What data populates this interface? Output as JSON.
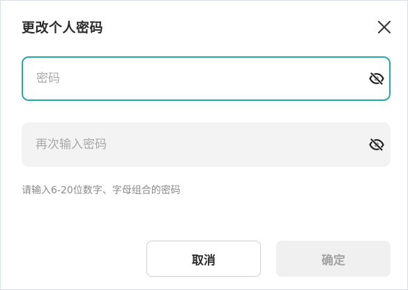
{
  "dialog": {
    "title": "更改个人密码",
    "close_icon": "close-icon"
  },
  "fields": [
    {
      "placeholder": "密码",
      "value": "",
      "toggle_icon": "eye-off-icon",
      "focused": true
    },
    {
      "placeholder": "再次输入密码",
      "value": "",
      "toggle_icon": "eye-off-icon",
      "focused": false
    }
  ],
  "hint": "请输入6-20位数字、字母组合的密码",
  "buttons": {
    "cancel_label": "取消",
    "confirm_label": "确定"
  },
  "colors": {
    "accent": "#22a8a8",
    "title_text": "#2b2b2b",
    "hint_text": "#8a8a8a",
    "disabled_text": "#a3a3a3",
    "disabled_bg": "#f0f0f0"
  }
}
